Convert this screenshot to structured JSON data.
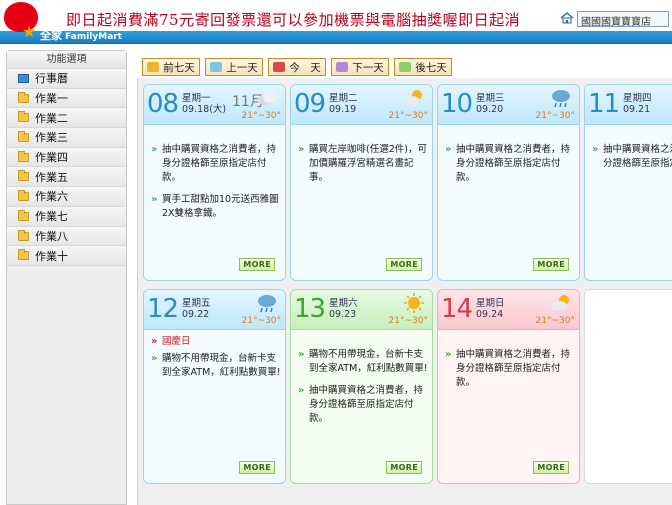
{
  "header": {
    "marquee": "即日起消費滿75元寄回發票還可以參加機票與電腦抽獎喔即日起消",
    "brand_cn": "全家",
    "brand_en": "FamilyMart",
    "store_box": "國國國寶寶寶店"
  },
  "sidebar": {
    "title": "功能選項",
    "items": [
      {
        "label": "行事曆",
        "icon": "monitor-icon"
      },
      {
        "label": "作業一",
        "icon": "folder-icon"
      },
      {
        "label": "作業二",
        "icon": "folder-icon"
      },
      {
        "label": "作業三",
        "icon": "folder-icon"
      },
      {
        "label": "作業四",
        "icon": "folder-icon"
      },
      {
        "label": "作業五",
        "icon": "folder-icon"
      },
      {
        "label": "作業六",
        "icon": "folder-icon"
      },
      {
        "label": "作業七",
        "icon": "folder-icon"
      },
      {
        "label": "作業八",
        "icon": "folder-icon"
      },
      {
        "label": "作業十",
        "icon": "folder-icon"
      }
    ]
  },
  "toolbar": {
    "prev7": "前七天",
    "prev1": "上一天",
    "today": "今　天",
    "next1": "下一天",
    "next7": "後七天"
  },
  "more_label": "MORE",
  "days": [
    {
      "num": "08",
      "weekday": "星期一",
      "date": "09.18(大)",
      "month": "11月",
      "temp": "21°~30°",
      "weather": "cloudy",
      "theme": "blue",
      "events": [
        "抽中購買資格之消費者，持身分證格篩至原指定店付款。",
        "買手工甜點加10元送西雅圖2X雙格拿鐵。"
      ]
    },
    {
      "num": "09",
      "weekday": "星期二",
      "date": "09.19",
      "temp": "21°~30°",
      "weather": "partly-sunny",
      "theme": "blue",
      "events": [
        "購買左岸咖啡(任選2件)，可加價購羅浮宮精選名畫記事。"
      ]
    },
    {
      "num": "10",
      "weekday": "星期三",
      "date": "09.20",
      "temp": "21°~30°",
      "weather": "rain",
      "theme": "blue",
      "events": [
        "抽中購買資格之消費者，持身分證格篩至原指定店付款。"
      ]
    },
    {
      "num": "11",
      "weekday": "星期四",
      "date": "09.21",
      "theme": "blue",
      "events": [
        "抽中購買資格之消費者，持身分證格篩至原指定店付款。"
      ]
    },
    {
      "num": "12",
      "weekday": "星期五",
      "date": "09.22",
      "temp": "21°~30°",
      "weather": "rain",
      "theme": "blue",
      "holiday": "國慶日",
      "events": [
        "購物不用帶現金，台新卡支到全家ATM，紅利點數買單!"
      ]
    },
    {
      "num": "13",
      "weekday": "星期六",
      "date": "09.23",
      "temp": "21°~30°",
      "weather": "sunny",
      "theme": "green",
      "events": [
        "購物不用帶現金，台新卡支到全家ATM，紅利點數買單!",
        "抽中購買資格之消費者，持身分證格篩至原指定店付款。"
      ]
    },
    {
      "num": "14",
      "weekday": "星期日",
      "date": "09.24",
      "temp": "21°~30°",
      "weather": "partly-sunny",
      "theme": "pink",
      "events": [
        "抽中購買資格之消費者，持身分證格篩至原指定店付款。"
      ]
    }
  ]
}
